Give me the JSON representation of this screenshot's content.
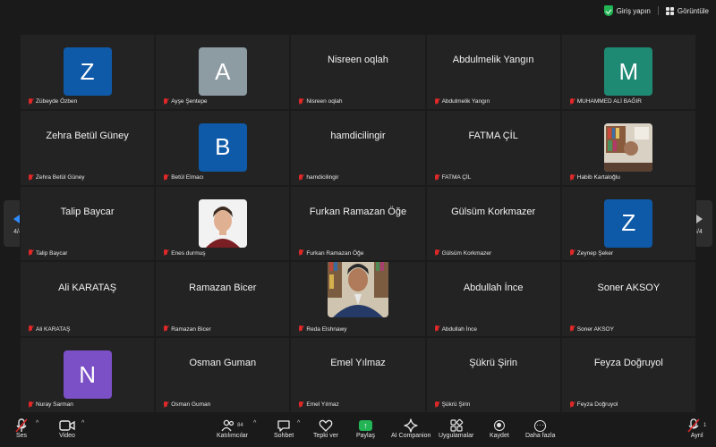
{
  "topbar": {
    "signin_label": "Giriş yapın",
    "view_label": "Görüntüle"
  },
  "nav": {
    "page_indicator": "4/4"
  },
  "colors": {
    "blue_avatar": "#0f5aa8",
    "gray_avatar": "#8d9ba3",
    "green_avatar": "#1f8a74",
    "purple_avatar": "#7b4fc6",
    "muted_icon": "#e02828",
    "share_green": "#22b455"
  },
  "participants": [
    {
      "display_name": "",
      "initial": "Z",
      "label": "Zübeyde Özben",
      "kind": "avatar",
      "color": "#0f5aa8"
    },
    {
      "display_name": "",
      "initial": "A",
      "label": "Ayşe Şentepe",
      "kind": "avatar",
      "color": "#8d9ba3"
    },
    {
      "display_name": "Nisreen oqlah",
      "initial": "",
      "label": "Nisreen oqlah",
      "kind": "name"
    },
    {
      "display_name": "Abdulmelik Yangın",
      "initial": "",
      "label": "Abdulmelik Yangın",
      "kind": "name"
    },
    {
      "display_name": "",
      "initial": "M",
      "label": "MUHAMMED ALİ BAĞIR",
      "kind": "avatar",
      "color": "#1f8a74"
    },
    {
      "display_name": "Zehra Betül Güney",
      "initial": "",
      "label": "Zehra Betül Güney",
      "kind": "name"
    },
    {
      "display_name": "",
      "initial": "B",
      "label": "Betül Elmacı",
      "kind": "avatar",
      "color": "#0f5aa8"
    },
    {
      "display_name": "hamdicilingir",
      "initial": "",
      "label": "hamdicilingir",
      "kind": "name"
    },
    {
      "display_name": "FATMA ÇİL",
      "initial": "",
      "label": "FATMA ÇİL",
      "kind": "name"
    },
    {
      "display_name": "",
      "initial": "",
      "label": "Habib Kartaloğlu",
      "kind": "photo-office"
    },
    {
      "display_name": "Talip Baycar",
      "initial": "",
      "label": "Talip Baycar",
      "kind": "name"
    },
    {
      "display_name": "",
      "initial": "",
      "label": "Enes durmuş",
      "kind": "photo-portrait"
    },
    {
      "display_name": "Furkan Ramazan Öğe",
      "initial": "",
      "label": "Furkan Ramazan Öğe",
      "kind": "name"
    },
    {
      "display_name": "Gülsüm Korkmazer",
      "initial": "",
      "label": "Gülsüm Korkmazer",
      "kind": "name"
    },
    {
      "display_name": "",
      "initial": "Z",
      "label": "Zeynep Şeker",
      "kind": "avatar",
      "color": "#0f5aa8"
    },
    {
      "display_name": "Ali KARATAŞ",
      "initial": "",
      "label": "Ali KARATAŞ",
      "kind": "name"
    },
    {
      "display_name": "Ramazan Bicer",
      "initial": "",
      "label": "Ramazan Bicer",
      "kind": "name"
    },
    {
      "display_name": "",
      "initial": "",
      "label": "Reda Elshnawy",
      "kind": "photo-library"
    },
    {
      "display_name": "Abdullah İnce",
      "initial": "",
      "label": "Abdullah İnce",
      "kind": "name"
    },
    {
      "display_name": "Soner AKSOY",
      "initial": "",
      "label": "Soner AKSOY",
      "kind": "name"
    },
    {
      "display_name": "",
      "initial": "N",
      "label": "Nuray Sarman",
      "kind": "avatar",
      "color": "#7b4fc6"
    },
    {
      "display_name": "Osman Guman",
      "initial": "",
      "label": "Osman Guman",
      "kind": "name"
    },
    {
      "display_name": "Emel Yılmaz",
      "initial": "",
      "label": "Emel Yılmaz",
      "kind": "name"
    },
    {
      "display_name": "Şükrü Şirin",
      "initial": "",
      "label": "Şükrü Şirin",
      "kind": "name"
    },
    {
      "display_name": "Feyza Doğruyol",
      "initial": "",
      "label": "Feyza Doğruyol",
      "kind": "name"
    }
  ],
  "toolbar": {
    "audio_label": "Ses",
    "video_label": "Video",
    "participants_label": "Katılımcılar",
    "participants_count": "84",
    "chat_label": "Sohbet",
    "reactions_label": "Tepki ver",
    "share_label": "Paylaş",
    "ai_label": "AI Companion",
    "apps_label": "Uygulamalar",
    "record_label": "Kaydet",
    "more_label": "Daha fazla",
    "leave_label": "Ayrıl",
    "leave_badge": "1"
  }
}
